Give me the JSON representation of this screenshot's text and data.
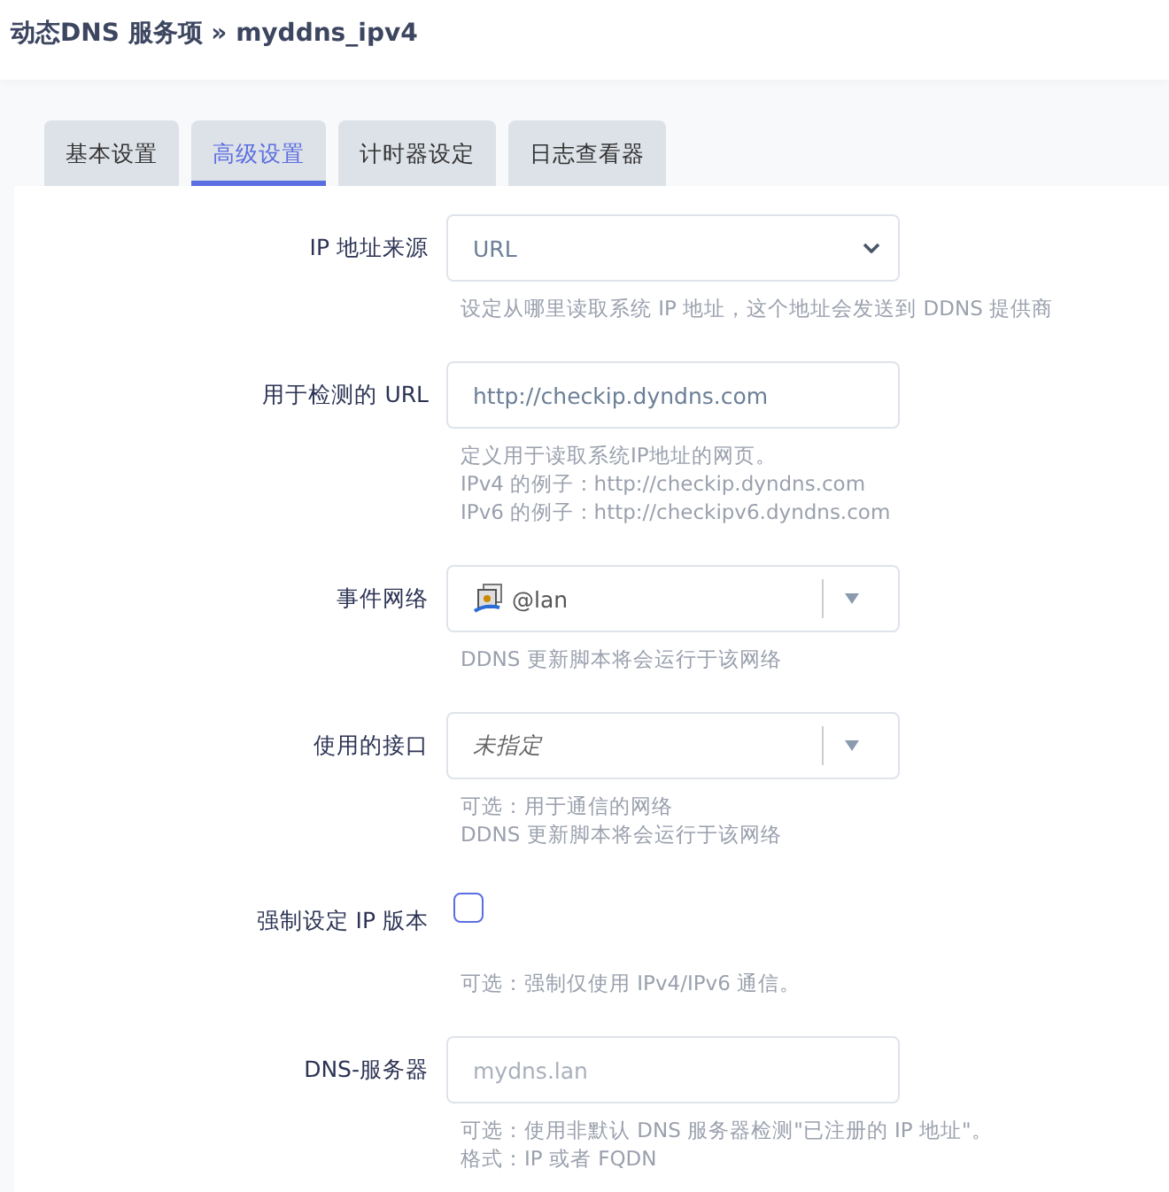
{
  "title": "动态DNS 服务项 » myddns_ipv4",
  "tabs": [
    {
      "label": "基本设置",
      "selected": false
    },
    {
      "label": "高级设置",
      "selected": true
    },
    {
      "label": "计时器设定",
      "selected": false
    },
    {
      "label": "日志查看器",
      "selected": false
    }
  ],
  "fields": [
    {
      "kind": "select",
      "label": "IP 地址来源",
      "value": "URL",
      "help": [
        "设定从哪里读取系统 IP 地址，这个地址会发送到 DDNS 提供商"
      ]
    },
    {
      "kind": "input",
      "label": "用于检测的 URL",
      "value": "http://checkip.dyndns.com",
      "help": [
        "定义用于读取系统IP地址的网页。",
        "IPv4 的例子 : http://checkip.dyndns.com",
        "IPv6 的例子 : http://checkipv6.dyndns.com"
      ]
    },
    {
      "kind": "network",
      "label": "事件网络",
      "value": "@lan",
      "help": [
        "DDNS 更新脚本将会运行于该网络"
      ]
    },
    {
      "kind": "combo",
      "label": "使用的接口",
      "value": "未指定",
      "help": [
        "可选：用于通信的网络",
        "DDNS 更新脚本将会运行于该网络"
      ]
    },
    {
      "kind": "checkbox",
      "label": "强制设定 IP 版本",
      "checked": false,
      "help": [
        "可选：强制仅使用 IPv4/IPv6 通信。"
      ]
    },
    {
      "kind": "input",
      "label": "DNS-服务器",
      "placeholder": "mydns.lan",
      "help": [
        "可选：使用非默认 DNS 服务器检测\"已注册的 IP 地址\"。",
        "格式：IP 或者 FQDN"
      ]
    }
  ]
}
